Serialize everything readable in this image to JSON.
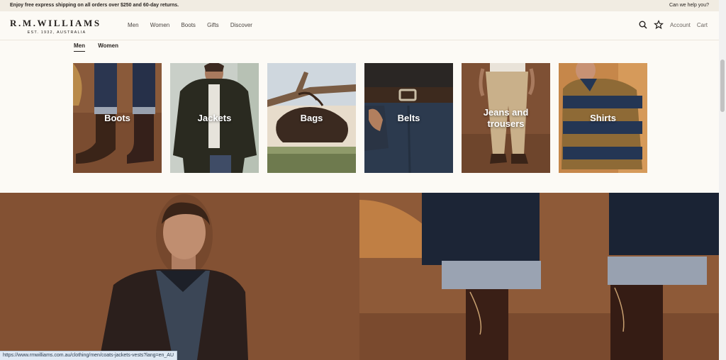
{
  "topbar": {
    "promo": "Enjoy free express shipping on all orders over $250 and 60-day returns.",
    "help": "Can we help you?"
  },
  "header": {
    "logo_name": "R.M.WILLIAMS",
    "logo_sub": "EST. 1932, AUSTRALIA",
    "nav": [
      "Men",
      "Women",
      "Boots",
      "Gifts",
      "Discover"
    ],
    "account": "Account",
    "cart": "Cart",
    "icons": [
      "search-icon",
      "star-icon"
    ]
  },
  "gender_tabs": [
    {
      "label": "Men",
      "active": true
    },
    {
      "label": "Women",
      "active": false
    }
  ],
  "categories": [
    {
      "label": "Boots"
    },
    {
      "label": "Jackets"
    },
    {
      "label": "Bags"
    },
    {
      "label": "Belts"
    },
    {
      "label": "Jeans and trousers"
    },
    {
      "label": "Shirts"
    }
  ],
  "status_url": "https://www.rmwilliams.com.au/clothing/men/coats-jackets-vests?lang=en_AU",
  "colors": {
    "background": "#fcfaf5",
    "topbar": "#f1ece2",
    "text": "#231f1c",
    "hero_brown": "#7a4a2e"
  }
}
